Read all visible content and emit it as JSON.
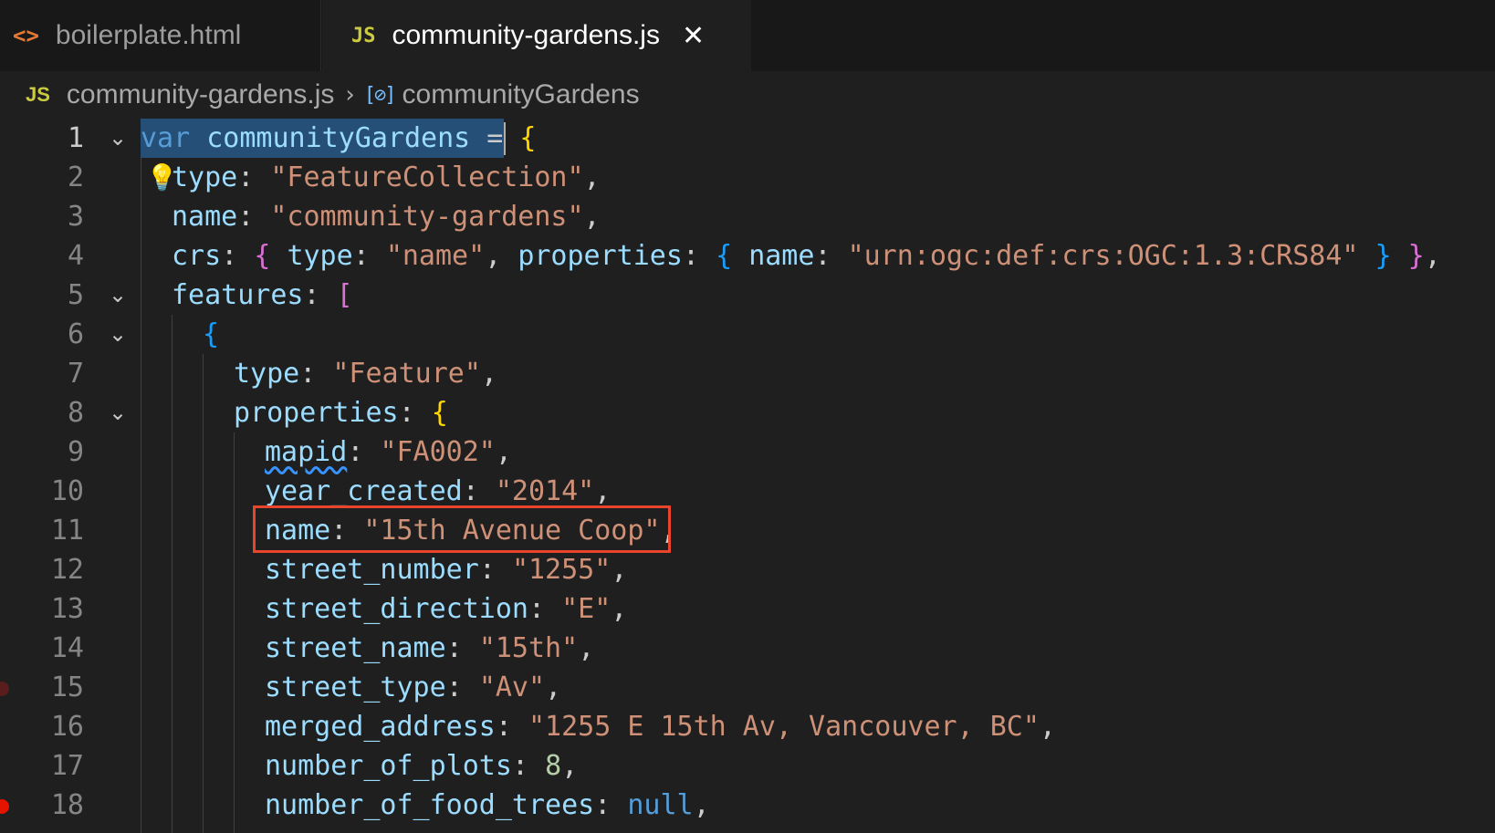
{
  "tabs": [
    {
      "icon": "<>",
      "label": "boilerplate.html",
      "active": false
    },
    {
      "icon": "JS",
      "label": "community-gardens.js",
      "active": true,
      "close": "✕"
    }
  ],
  "breadcrumb": {
    "file_icon": "JS",
    "file": "community-gardens.js",
    "separator": "›",
    "symbol_icon": "[⊘]",
    "symbol": "communityGardens"
  },
  "editor": {
    "lines": [
      {
        "n": "1"
      },
      {
        "n": "2"
      },
      {
        "n": "3"
      },
      {
        "n": "4"
      },
      {
        "n": "5"
      },
      {
        "n": "6"
      },
      {
        "n": "7"
      },
      {
        "n": "8"
      },
      {
        "n": "9"
      },
      {
        "n": "10"
      },
      {
        "n": "11"
      },
      {
        "n": "12"
      },
      {
        "n": "13"
      },
      {
        "n": "14"
      },
      {
        "n": "15"
      },
      {
        "n": "16"
      },
      {
        "n": "17"
      },
      {
        "n": "18"
      }
    ],
    "code": {
      "l1_var": "var",
      "l1_name": "communityGardens",
      "l1_eq": "=",
      "l2_key": "type",
      "l2_val": "\"FeatureCollection\"",
      "l3_key": "name",
      "l3_val": "\"community-gardens\"",
      "l4_key": "crs",
      "l4_type_key": "type",
      "l4_type_val": "\"name\"",
      "l4_props_key": "properties",
      "l4_name_key": "name",
      "l4_name_val": "\"urn:ogc:def:crs:OGC:1.3:CRS84\"",
      "l5_key": "features",
      "l7_key": "type",
      "l7_val": "\"Feature\"",
      "l8_key": "properties",
      "l9_key": "mapid",
      "l9_val": "\"FA002\"",
      "l10_key": "year_created",
      "l10_val": "\"2014\"",
      "l11_key": "name",
      "l11_val": "\"15th Avenue Coop\"",
      "l12_key": "street_number",
      "l12_val": "\"1255\"",
      "l13_key": "street_direction",
      "l13_val": "\"E\"",
      "l14_key": "street_name",
      "l14_val": "\"15th\"",
      "l15_key": "street_type",
      "l15_val": "\"Av\"",
      "l16_key": "merged_address",
      "l16_val": "\"1255 E 15th Av, Vancouver, BC\"",
      "l17_key": "number_of_plots",
      "l17_val": "8",
      "l18_key": "number_of_food_trees",
      "l18_val": "null"
    }
  },
  "colors": {
    "keyword": "#569cd6",
    "property": "#9cdcfe",
    "string": "#ce9178",
    "number": "#b5cea8",
    "highlight_box": "#e8452c"
  }
}
